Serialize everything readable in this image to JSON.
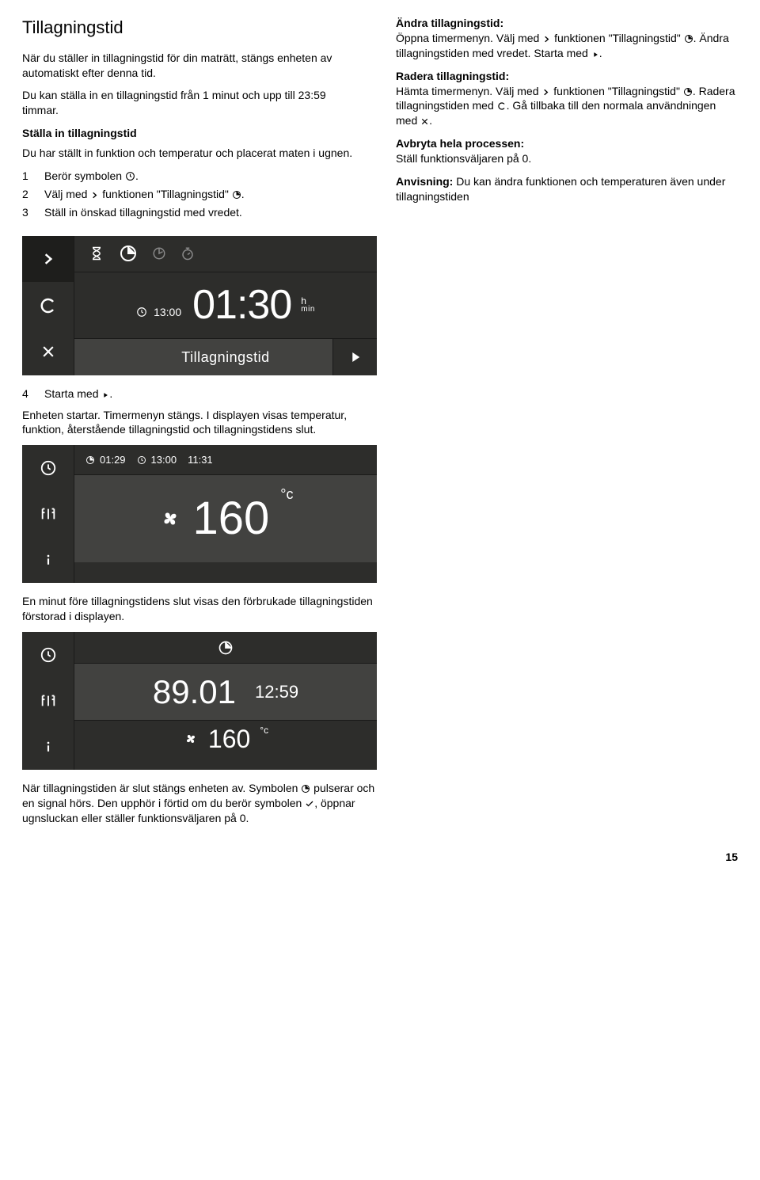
{
  "page_number": "15",
  "left": {
    "title": "Tillagningstid",
    "p1": "När du ställer in tillagningstid för din maträtt, stängs enheten av automatiskt efter denna tid.",
    "p2": "Du kan ställa in en tillagningstid från 1 minut och upp till 23:59 timmar.",
    "sub1": "Ställa in tillagningstid",
    "p3": "Du har ställt in funktion och temperatur och placerat maten i ugnen.",
    "step1num": "1",
    "step1a": "Berör symbolen ",
    "step1b": ".",
    "step2num": "2",
    "step2a": "Välj med ",
    "step2b": " funktionen \"Tillagningstid\" ",
    "step2c": ".",
    "step3num": "3",
    "step3": "Ställ in önskad tillagningstid med vredet.",
    "step4num": "4",
    "step4a": "Starta med ",
    "step4b": ".",
    "p4": "Enheten startar. Timermenyn stängs. I displayen visas temperatur, funktion, återstående tillagningstid och tillagningstidens slut.",
    "p5": "En minut före tillagningstidens slut visas den förbrukade tillagningstiden förstorad i displayen.",
    "p6a": "När tillagningstiden är slut stängs enheten av. Symbolen ",
    "p6b": " pulserar och en signal hörs. Den upphör i förtid om du berör symbolen ",
    "p6c": ", öppnar ugnsluckan eller ställer funktionsväljaren på 0."
  },
  "right": {
    "r1head": "Ändra tillagningstid:",
    "r1a": "Öppna timermenyn. Välj med ",
    "r1b": " funktionen \"Tillagningstid\" ",
    "r1c": ". Ändra tillagningstiden med vredet. Starta med ",
    "r1d": ".",
    "r2head": "Radera tillagningstid:",
    "r2a": "Hämta timermenyn. Välj med ",
    "r2b": " funktionen \"Tillagningstid\" ",
    "r2c": ". Radera tillagningstiden med ",
    "r2d": ". Gå tillbaka till den normala användningen med ",
    "r2e": ".",
    "r3head": "Avbryta hela processen:",
    "r3": "Ställ funktionsväljaren på 0.",
    "r4head": "Anvisning: ",
    "r4": "Du kan ändra funktionen och temperaturen även under tillagningstiden"
  },
  "panel1": {
    "smalltime": "13:00",
    "bigtime": "01:30",
    "unit_h": "h",
    "unit_min": "min",
    "label": "Tillagningstid"
  },
  "panel2": {
    "t1": "01:29",
    "t2": "13:00",
    "t3": "11:31",
    "temp": "160",
    "deg": "°c"
  },
  "panel3": {
    "elapsed": "89.01",
    "endtime": "12:59",
    "temp": "160",
    "deg": "°c"
  }
}
